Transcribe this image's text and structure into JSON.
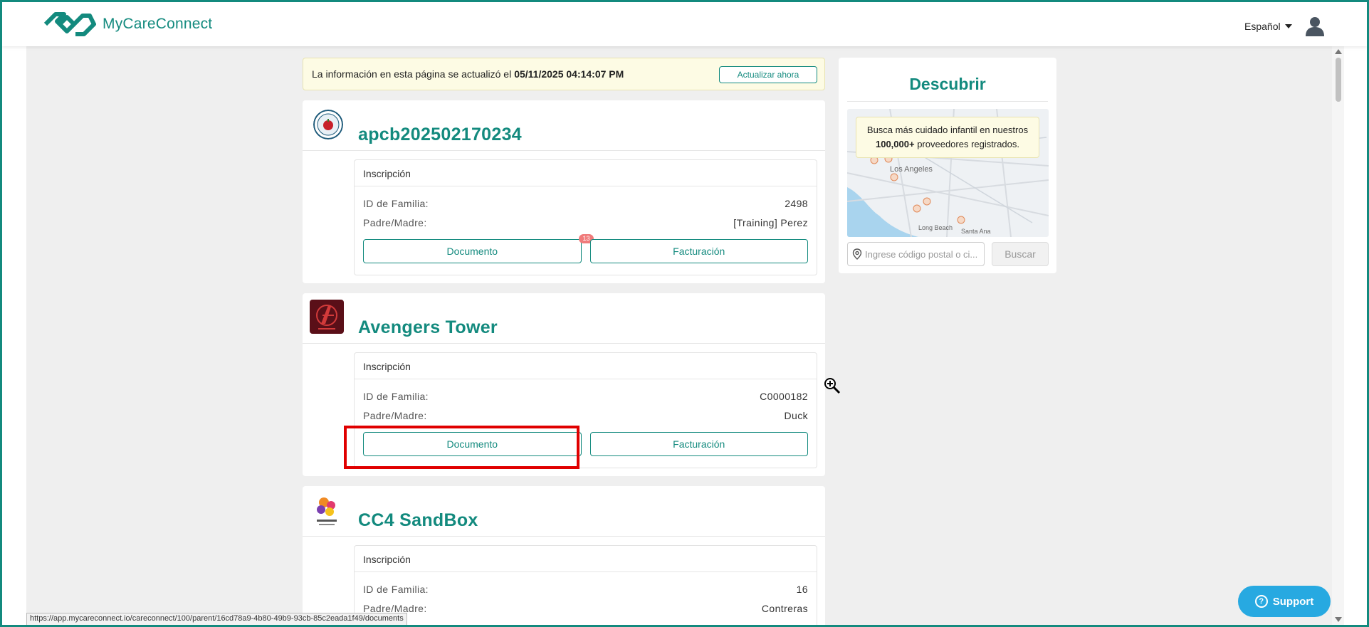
{
  "app": {
    "brand": "MyCareConnect",
    "language": "Español",
    "accent_color": "#138a7e"
  },
  "banner": {
    "text": "La información en esta página se actualizó el",
    "timestamp": "05/11/2025 04:14:07 PM",
    "refresh_label": "Actualizar ahora"
  },
  "providers": [
    {
      "name": "apcb202502170234",
      "enrollment_title": "Inscripción",
      "family_id_label": "ID de Familia:",
      "family_id": "2498",
      "parent_label": "Padre/Madre:",
      "parent": "[Training] Perez",
      "document_label": "Documento",
      "billing_label": "Facturación",
      "document_badge": "13"
    },
    {
      "name": "Avengers Tower",
      "enrollment_title": "Inscripción",
      "family_id_label": "ID de Familia:",
      "family_id": "C0000182",
      "parent_label": "Padre/Madre:",
      "parent": "Duck",
      "document_label": "Documento",
      "billing_label": "Facturación"
    },
    {
      "name": "CC4 SandBox",
      "enrollment_title": "Inscripción",
      "family_id_label": "ID de Familia:",
      "family_id": "16",
      "parent_label": "Padre/Madre:",
      "parent": "Contreras"
    }
  ],
  "discover": {
    "title": "Descubrir",
    "note_text_1": "Busca más cuidado infantil en nuestros",
    "note_bold": "100,000+",
    "note_text_2": "proveedores registrados.",
    "search_placeholder": "Ingrese código postal o ci...",
    "search_button": "Buscar",
    "map_labels": [
      "Los Angeles",
      "Long Beach",
      "Santa Ana"
    ]
  },
  "support_label": "Support",
  "status_url": "https://app.mycareconnect.io/careconnect/100/parent/16cd78a9-4b80-49b9-93cb-85c2eada1f49/documents"
}
